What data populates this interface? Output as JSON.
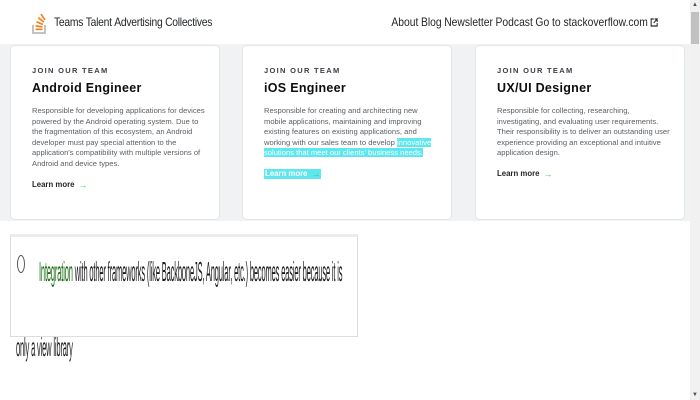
{
  "header": {
    "brand": [
      "Teams",
      "Talent",
      "Advertising",
      "Collectives"
    ],
    "nav": [
      "About",
      "Blog",
      "Newsletter",
      "Podcast",
      "Go to stackoverflow.com"
    ],
    "external_icon": "external-link-icon",
    "logo_icon": "stack-overflow-logo-icon"
  },
  "cards": [
    {
      "eyebrow": "JOIN OUR TEAM",
      "title": "Android Engineer",
      "description": "Responsible for developing applications for devices powered by the Android operating system. Due to the fragmentation of this ecosystem, an Android developer must pay special attention to the application's compatibility with multiple versions of Android and device types.",
      "learn_more": "Learn more"
    },
    {
      "eyebrow": "JOIN OUR TEAM",
      "title": "iOS Engineer",
      "description": "Responsible for creating and architecting new mobile applications, maintaining and improving existing features on existing applications, and working with our sales team to develop",
      "description_highlight": "innovative solutions that meet our clients' business needs.",
      "learn_more": "Learn more"
    },
    {
      "eyebrow": "JOIN OUR TEAM",
      "title": "UX/UI Designer",
      "description": "Responsible for collecting, researching, investigating, and evaluating user requirements. Their responsibility is to deliver an outstanding user experience providing an exceptional and intuitive application design.",
      "learn_more": "Learn more"
    }
  ],
  "overlay": {
    "text_green": "Integration",
    "text_rest": " with other frameworks (like BackboneJS, Angular, etc.) becomes easier because it is",
    "text_more": "only a view library"
  },
  "colors": {
    "highlight": "#5ee7ef",
    "arrow_green": "#2fd55b",
    "logo_orange": "#f48024"
  }
}
